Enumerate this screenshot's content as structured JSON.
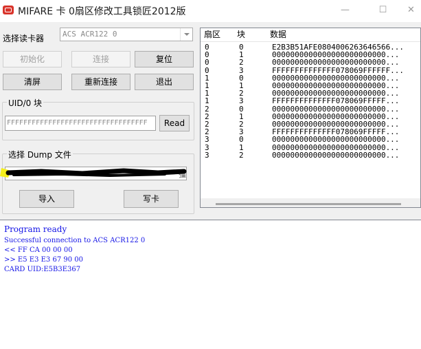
{
  "window": {
    "title": "MIFARE 卡 0扇区修改工具锁匠2012版",
    "minimize": "—",
    "maximize": "☐",
    "close": "✕"
  },
  "reader": {
    "label": "选择读卡器",
    "selected": "ACS ACR122 0"
  },
  "buttons": {
    "init": "初始化",
    "connect": "连接",
    "reset": "复位",
    "clear": "清屏",
    "reconnect": "重新连接",
    "exit": "退出",
    "read": "Read",
    "import": "导入",
    "write": "写卡"
  },
  "uid_group": {
    "title": "UID/0 块",
    "value": "FFFFFFFFFFFFFFFFFFFFFFFFFFFFFFFFFF"
  },
  "dump_group": {
    "title": "选择 Dump 文件",
    "visible_suffix": "彊|"
  },
  "table": {
    "headers": [
      "扇区",
      "块",
      "数据"
    ],
    "rows": [
      [
        "0",
        "0",
        "E2B3B51AFE0804006263646566..."
      ],
      [
        "0",
        "1",
        "0000000000000000000000000..."
      ],
      [
        "0",
        "2",
        "0000000000000000000000000..."
      ],
      [
        "0",
        "3",
        "FFFFFFFFFFFFFF078069FFFFFF..."
      ],
      [
        "1",
        "0",
        "0000000000000000000000000..."
      ],
      [
        "1",
        "1",
        "0000000000000000000000000..."
      ],
      [
        "1",
        "2",
        "0000000000000000000000000..."
      ],
      [
        "1",
        "3",
        "FFFFFFFFFFFFFF078069FFFFF..."
      ],
      [
        "2",
        "0",
        "0000000000000000000000000..."
      ],
      [
        "2",
        "1",
        "0000000000000000000000000..."
      ],
      [
        "2",
        "2",
        "0000000000000000000000000..."
      ],
      [
        "2",
        "3",
        "FFFFFFFFFFFFFF078069FFFFF..."
      ],
      [
        "3",
        "0",
        "0000000000000000000000000..."
      ],
      [
        "3",
        "1",
        "0000000000000000000000000..."
      ],
      [
        "3",
        "2",
        "0000000000000000000000000..."
      ]
    ]
  },
  "log": {
    "lines": [
      "Program ready",
      "Successful connection to ACS ACR122 0",
      "<< FF CA 00 00 00",
      ">> E5 E3 E3 67 90 00",
      "CARD UID:E5B3E367"
    ]
  },
  "colors": {
    "log_text": "#1414e6",
    "highlight": "#f5ef1a"
  }
}
